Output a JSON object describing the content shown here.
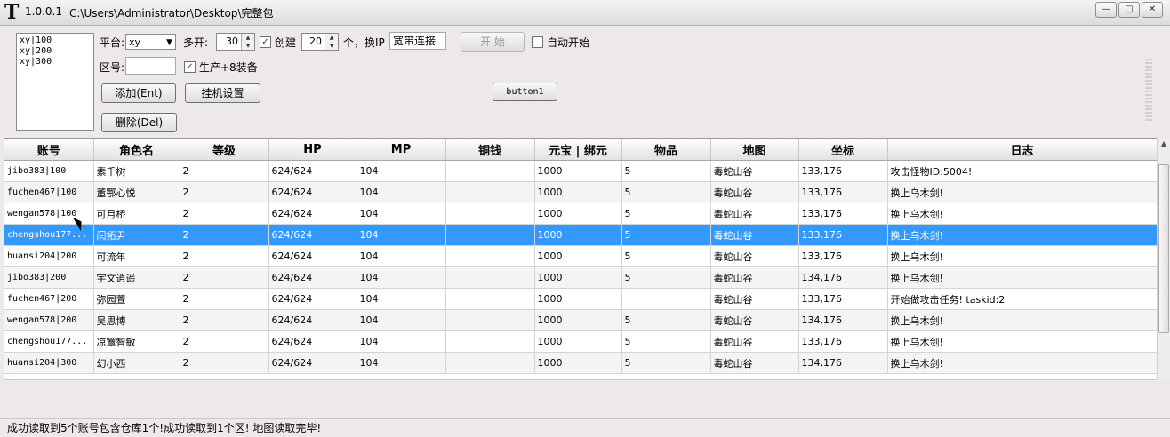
{
  "window": {
    "version": "1.0.0.1",
    "path": "C:\\Users\\Administrator\\Desktop\\完整包",
    "app_icon": "T",
    "min_label": "—",
    "max_label": "□",
    "close_label": "✕"
  },
  "account_list": [
    "xy|100",
    "xy|200",
    "xy|300"
  ],
  "controls": {
    "platform_label": "平台:",
    "platform_value": "xy",
    "multi_label": "多开:",
    "multi_value": "30",
    "create_label": "创建",
    "create_checked": true,
    "create_value": "20",
    "change_ip_label": "个，换IP",
    "change_ip_value": "宽带连接",
    "start_label": "开 始",
    "auto_start_label": "自动开始",
    "auto_start_checked": false,
    "zone_label": "区号:",
    "produce_label": "生产+8装备",
    "produce_checked": true,
    "add_label": "添加(Ent)",
    "hangup_label": "挂机设置",
    "button1_label": "button1",
    "delete_label": "删除(Del)"
  },
  "table": {
    "columns": [
      "账号",
      "角色名",
      "等级",
      "HP",
      "MP",
      "铜钱",
      "元宝 | 绑元",
      "物品",
      "地图",
      "坐标",
      "日志"
    ],
    "rows": [
      [
        "jibo383|100",
        "素千树",
        "2",
        "624/624",
        "104",
        "",
        "1000",
        "5",
        "毒蛇山谷",
        "133,176",
        "攻击怪物ID:5004!"
      ],
      [
        "fuchen467|100",
        "董鄂心悦",
        "2",
        "624/624",
        "104",
        "",
        "1000",
        "5",
        "毒蛇山谷",
        "133,176",
        "换上乌木剑!"
      ],
      [
        "wengan578|100",
        "可月桥",
        "2",
        "624/624",
        "104",
        "",
        "1000",
        "5",
        "毒蛇山谷",
        "133,176",
        "换上乌木剑!"
      ],
      [
        "chengshou177...",
        "闫拓尹",
        "2",
        "624/624",
        "104",
        "",
        "1000",
        "5",
        "毒蛇山谷",
        "133,176",
        "换上乌木剑!"
      ],
      [
        "huansi204|200",
        "可流年",
        "2",
        "624/624",
        "104",
        "",
        "1000",
        "5",
        "毒蛇山谷",
        "133,176",
        "换上乌木剑!"
      ],
      [
        "jibo383|200",
        "宇文逍遥",
        "2",
        "624/624",
        "104",
        "",
        "1000",
        "5",
        "毒蛇山谷",
        "134,176",
        "换上乌木剑!"
      ],
      [
        "fuchen467|200",
        "弥园萱",
        "2",
        "624/624",
        "104",
        "",
        "1000",
        "",
        "毒蛇山谷",
        "133,176",
        "开始做攻击任务! taskid:2"
      ],
      [
        "wengan578|200",
        "吴思博",
        "2",
        "624/624",
        "104",
        "",
        "1000",
        "5",
        "毒蛇山谷",
        "134,176",
        "换上乌木剑!"
      ],
      [
        "chengshou177...",
        "凉簟智敏",
        "2",
        "624/624",
        "104",
        "",
        "1000",
        "5",
        "毒蛇山谷",
        "133,176",
        "换上乌木剑!"
      ],
      [
        "huansi204|300",
        "幻小西",
        "2",
        "624/624",
        "104",
        "",
        "1000",
        "5",
        "毒蛇山谷",
        "134,176",
        "换上乌木剑!"
      ]
    ],
    "selected_row": 3
  },
  "status": {
    "message": "成功读取到5个账号包含仓库1个!成功读取到1个区!   地图读取完毕!"
  },
  "colors": {
    "selection": "#3399ff",
    "window_bg": "#ece9e8"
  }
}
